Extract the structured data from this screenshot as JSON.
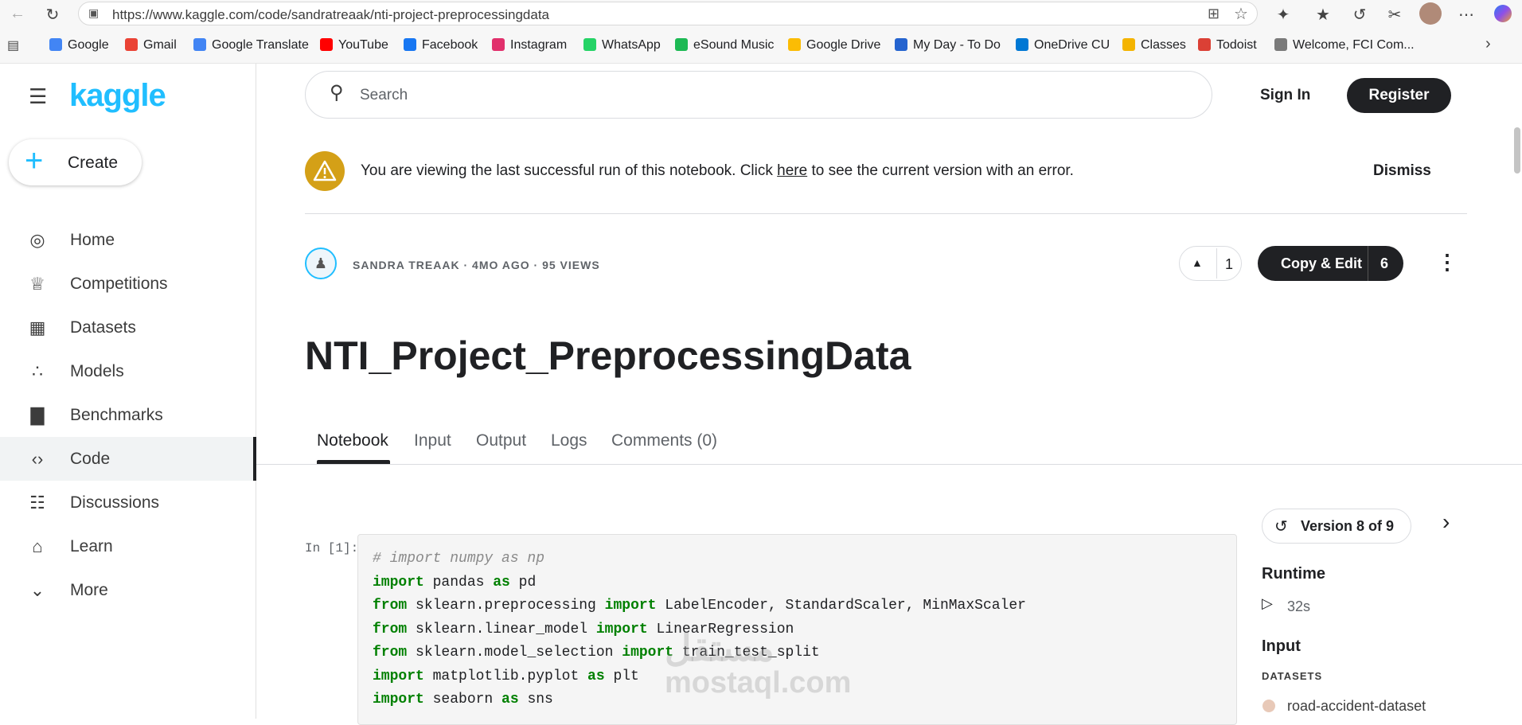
{
  "browser": {
    "url": "https://www.kaggle.com/code/sandratreaak/nti-project-preprocessingdata",
    "bookmarks": [
      {
        "label": "Google",
        "color": "#4285f4"
      },
      {
        "label": "Gmail",
        "color": "#ea4335"
      },
      {
        "label": "Google Translate",
        "color": "#4285f4"
      },
      {
        "label": "YouTube",
        "color": "#ff0000"
      },
      {
        "label": "Facebook",
        "color": "#1877f2"
      },
      {
        "label": "Instagram",
        "color": "#e1306c"
      },
      {
        "label": "WhatsApp",
        "color": "#25d366"
      },
      {
        "label": "eSound Music",
        "color": "#1db954"
      },
      {
        "label": "Google Drive",
        "color": "#fbbc04"
      },
      {
        "label": "My Day - To Do",
        "color": "#2564cf"
      },
      {
        "label": "OneDrive CU",
        "color": "#0078d4"
      },
      {
        "label": "Classes",
        "color": "#f4b400"
      },
      {
        "label": "Todoist",
        "color": "#db4035"
      },
      {
        "label": "Welcome, FCI Com...",
        "color": "#7a7a7a"
      }
    ]
  },
  "sidebar": {
    "logo": "kaggle",
    "create_label": "Create",
    "items": [
      {
        "label": "Home",
        "icon": "compass-icon"
      },
      {
        "label": "Competitions",
        "icon": "trophy-icon"
      },
      {
        "label": "Datasets",
        "icon": "table-icon"
      },
      {
        "label": "Models",
        "icon": "models-icon"
      },
      {
        "label": "Benchmarks",
        "icon": "bar-chart-icon"
      },
      {
        "label": "Code",
        "icon": "code-icon",
        "active": true
      },
      {
        "label": "Discussions",
        "icon": "discussion-icon"
      },
      {
        "label": "Learn",
        "icon": "school-icon"
      },
      {
        "label": "More",
        "icon": "chevron-down-icon"
      }
    ]
  },
  "header": {
    "search_placeholder": "Search",
    "sign_in": "Sign In",
    "register": "Register"
  },
  "banner": {
    "text_before": "You are viewing the last successful run of this notebook. Click ",
    "link": "here",
    "text_after": " to see the current version with an error.",
    "dismiss": "Dismiss"
  },
  "notebook": {
    "meta": "SANDRA TREAAK · 4MO AGO · 95 VIEWS",
    "votes": "1",
    "copy_edit": "Copy & Edit",
    "copy_count": "6",
    "title": "NTI_Project_PreprocessingData",
    "tabs": [
      "Notebook",
      "Input",
      "Output",
      "Logs",
      "Comments (0)"
    ],
    "active_tab": "Notebook",
    "cell_label": "In [1]:"
  },
  "code_lines": [
    [
      {
        "t": "# import numpy as np",
        "c": "cm"
      }
    ],
    [
      {
        "t": "import",
        "c": "kw"
      },
      {
        "t": " pandas "
      },
      {
        "t": "as",
        "c": "kw"
      },
      {
        "t": " pd"
      }
    ],
    [
      {
        "t": "from",
        "c": "kw"
      },
      {
        "t": " sklearn.preprocessing "
      },
      {
        "t": "import",
        "c": "kw"
      },
      {
        "t": " LabelEncoder, StandardScaler, MinMaxScaler"
      }
    ],
    [
      {
        "t": "from",
        "c": "kw"
      },
      {
        "t": " sklearn.linear_model "
      },
      {
        "t": "import",
        "c": "kw"
      },
      {
        "t": " LinearRegression"
      }
    ],
    [
      {
        "t": "from",
        "c": "kw"
      },
      {
        "t": " sklearn.model_selection "
      },
      {
        "t": "import",
        "c": "kw"
      },
      {
        "t": " train_test_split"
      }
    ],
    [
      {
        "t": "import",
        "c": "kw"
      },
      {
        "t": " matplotlib.pyplot "
      },
      {
        "t": "as",
        "c": "kw"
      },
      {
        "t": " plt"
      }
    ],
    [
      {
        "t": "import",
        "c": "kw"
      },
      {
        "t": " seaborn "
      },
      {
        "t": "as",
        "c": "kw"
      },
      {
        "t": " sns"
      }
    ]
  ],
  "right_panel": {
    "version": "Version 8 of 9",
    "runtime_heading": "Runtime",
    "runtime_value": "32s",
    "input_heading": "Input",
    "datasets_label": "DATASETS",
    "dataset_name": "road-accident-dataset"
  },
  "watermark": {
    "line1": "مستقل",
    "line2": "mostaql.com"
  }
}
